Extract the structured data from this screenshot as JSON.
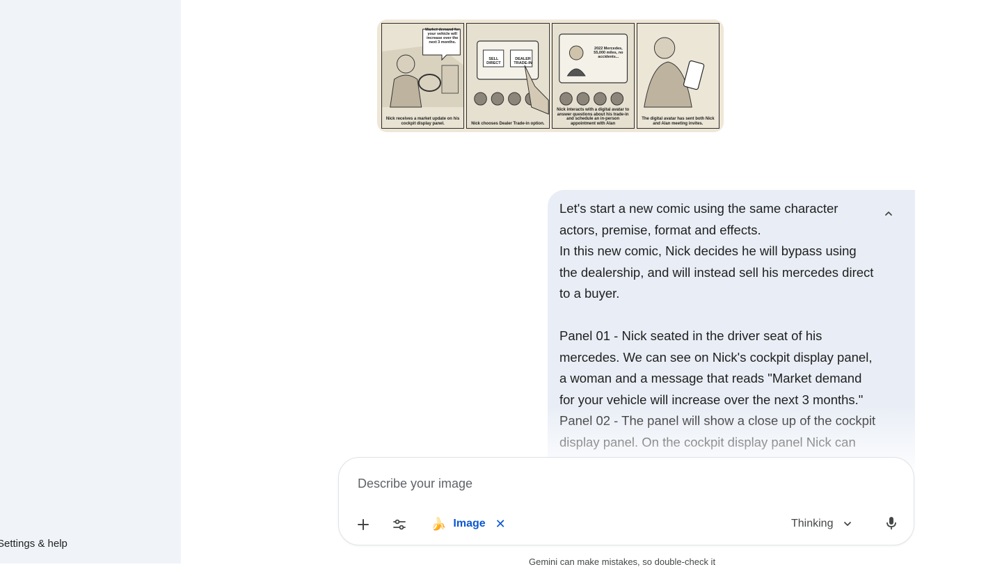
{
  "sidebar": {
    "settings_label": "Settings & help"
  },
  "comic": {
    "panels": [
      {
        "bubble": "Market demand for your vehicle will increase over the next 3 months.",
        "caption": "Nick receives a market update on his cockpit display panel."
      },
      {
        "screen_buttons": [
          "SELL DIRECT",
          "DEALER TRADE-IN"
        ],
        "caption": "Nick chooses Dealer Trade-in option."
      },
      {
        "screen_text": "2022 Mercedes, 55,000 miles, no accidents...",
        "caption": "Nick interacts with a digital avatar to answer questions about his trade-in and schedule an in-person appointment with Alan"
      },
      {
        "caption": "The digital avatar has sent both Nick and Alan meeting invites."
      }
    ]
  },
  "user_message": {
    "text": "Let's start a new comic using the same character actors, premise, format and effects.\nIn this new comic, Nick decides he will bypass using the dealership, and will instead sell his mercedes direct to a buyer.\n\nPanel 01 - Nick seated in the driver seat of his mercedes. We can see on Nick's cockpit display panel, a woman and a message that reads \"Market demand for your vehicle will increase over the next 3 months.\"\nPanel 02 - The panel will show a close up of the cockpit display panel. On the cockpit display panel Nick can"
  },
  "composer": {
    "placeholder": "Describe your image",
    "value": "",
    "chip_emoji": "🍌",
    "chip_label": "Image",
    "mode_label": "Thinking"
  },
  "footer": {
    "disclaimer": "Gemini can make mistakes, so double-check it"
  },
  "icons": {
    "add": "plus-icon",
    "tools": "tune-icon",
    "close": "close-icon",
    "chevron": "chevron-down-icon",
    "collapse": "chevron-up-icon",
    "mic": "mic-icon"
  },
  "colors": {
    "sidebar_bg": "#f0f4f9",
    "bubble_bg": "#e9eef6",
    "accent": "#0b57d0"
  }
}
